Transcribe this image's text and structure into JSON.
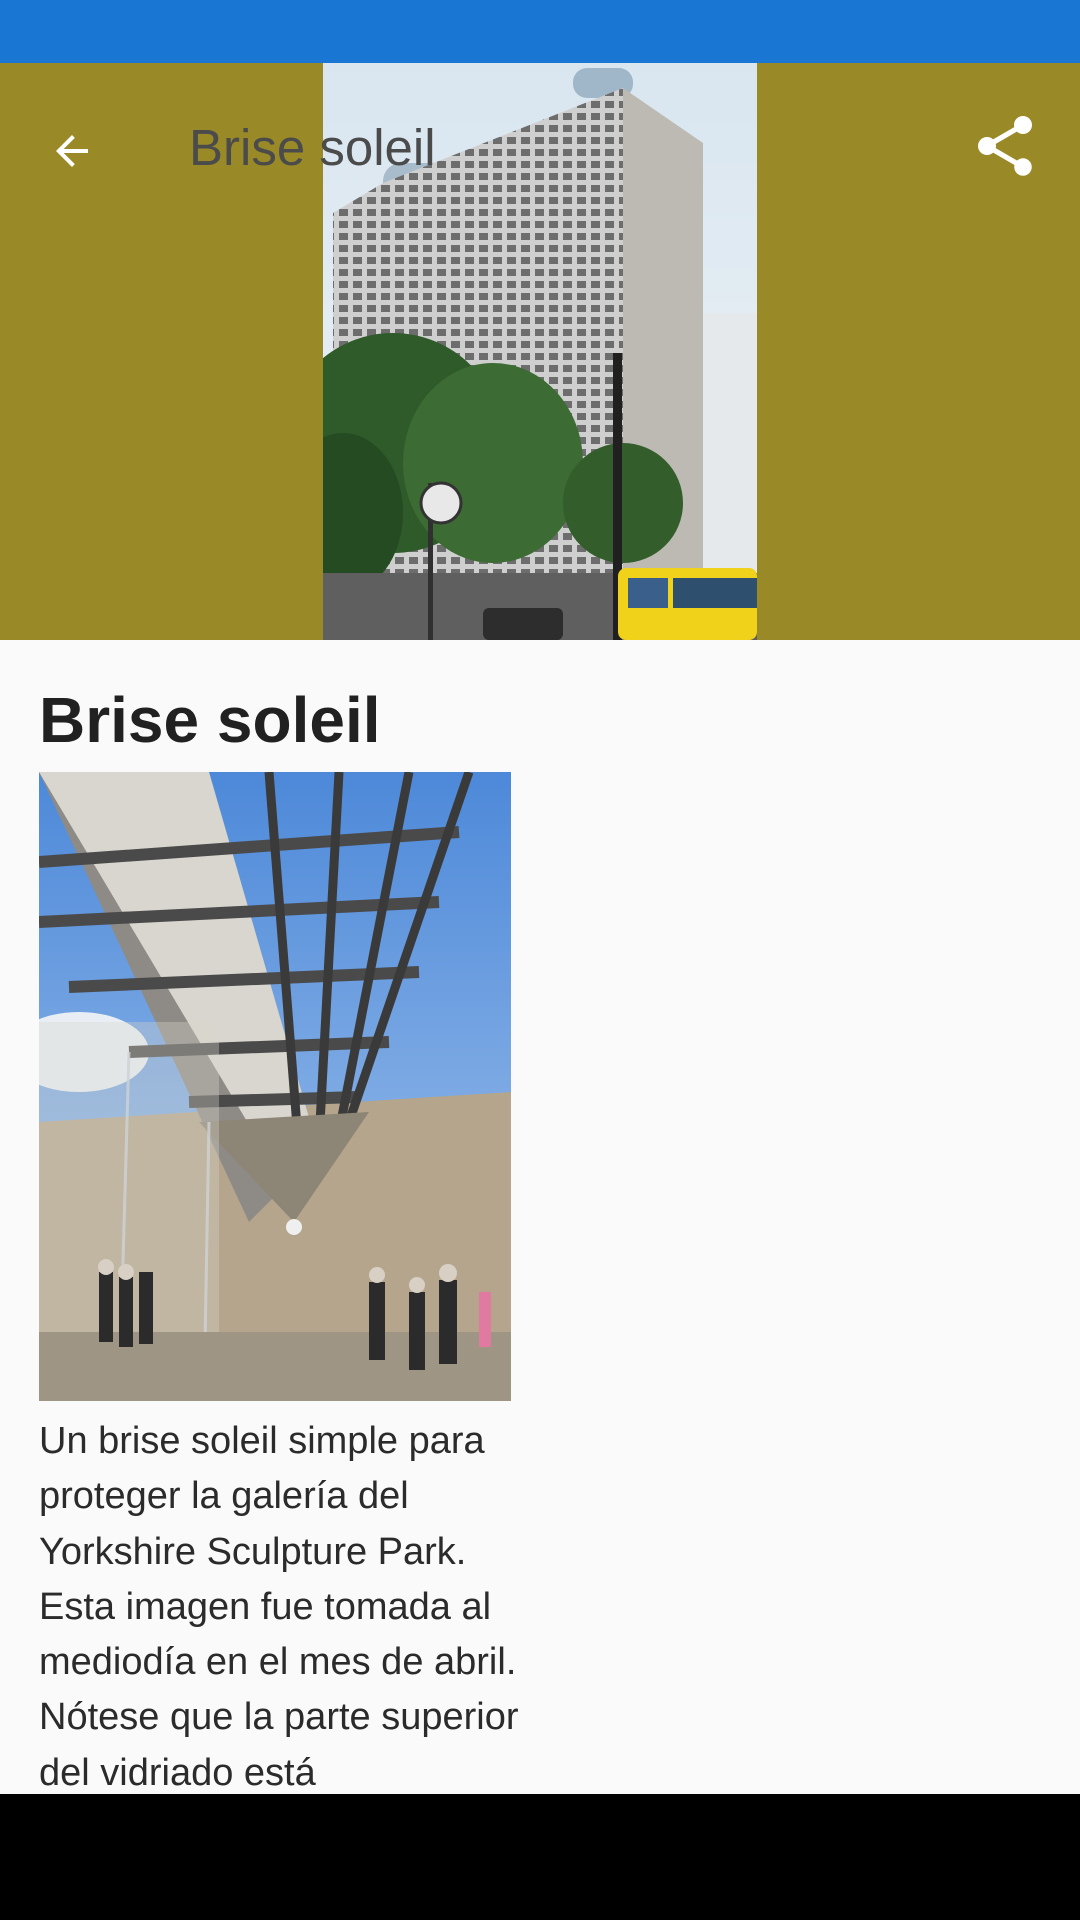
{
  "colors": {
    "status_bar": "#1976d2",
    "header_background": "#9a8a27",
    "title_text": "#4b4b4b",
    "page_background": "#fafafa",
    "nav_bar": "#000000"
  },
  "toolbar": {
    "back_icon": "arrow-left-icon",
    "title": "Brise soleil",
    "share_icon": "share-icon"
  },
  "hero_image": {
    "depicts": "tall-office-building-with-brise-soleil-facade"
  },
  "article": {
    "title": "Brise soleil",
    "figure_depicts": "brise-soleil-over-gallery-with-visitors",
    "caption": "Un brise soleil simple para proteger la galería del Yorkshire Sculpture Park. Esta imagen fue tomada al mediodía en el mes de abril. Nótese que la parte superior del vidriado está"
  }
}
